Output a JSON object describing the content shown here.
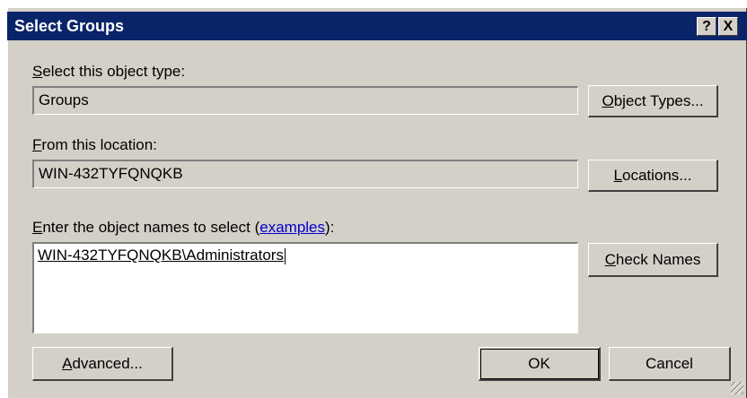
{
  "window": {
    "title": "Select Groups",
    "help_btn": "?",
    "close_btn": "X"
  },
  "object_type": {
    "label_first": "S",
    "label_rest": "elect this object type:",
    "value": "Groups",
    "button_first": "O",
    "button_rest": "bject Types..."
  },
  "location": {
    "label_first": "F",
    "label_rest": "rom this location:",
    "value": "WIN-432TYFQNQKB",
    "button_first": "L",
    "button_rest": "ocations..."
  },
  "names": {
    "label_first": "E",
    "label_rest": "nter the object names to select (",
    "link": "examples",
    "label_end": "):",
    "value": "WIN-432TYFQNQKB\\Administrators",
    "button_first": "C",
    "button_rest": "heck Names"
  },
  "footer": {
    "advanced_first": "A",
    "advanced_rest": "dvanced...",
    "ok": "OK",
    "cancel": "Cancel"
  }
}
